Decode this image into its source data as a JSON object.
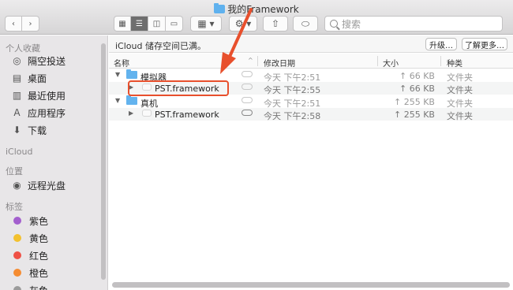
{
  "window": {
    "title": "我的Framework"
  },
  "toolbar": {
    "back": "‹",
    "forward": "›",
    "view_icon": "▦",
    "view_list": "☰",
    "view_column": "◫",
    "view_gallery": "▭",
    "group_label": "▦ ▾",
    "action_label": "⚙ ▾",
    "share_label": "⇧",
    "tag_label": "⬭",
    "search_placeholder": "搜索"
  },
  "sidebar": {
    "favorites_header": "个人收藏",
    "favorites": [
      {
        "label": "隔空投送",
        "icon": "airdrop-icon"
      },
      {
        "label": "桌面",
        "icon": "desktop-icon"
      },
      {
        "label": "最近使用",
        "icon": "recents-icon"
      },
      {
        "label": "应用程序",
        "icon": "applications-icon"
      },
      {
        "label": "下载",
        "icon": "downloads-icon"
      }
    ],
    "icloud_header": "iCloud",
    "locations_header": "位置",
    "locations": [
      {
        "label": "远程光盘",
        "icon": "disc-icon"
      }
    ],
    "tags_header": "标签",
    "tags": [
      {
        "label": "紫色",
        "color": "#a35fce"
      },
      {
        "label": "黄色",
        "color": "#f3c12f"
      },
      {
        "label": "红色",
        "color": "#ef5045"
      },
      {
        "label": "橙色",
        "color": "#f58c32"
      },
      {
        "label": "灰色",
        "color": "#9b9b9b"
      }
    ]
  },
  "icloud_bar": {
    "message": "iCloud 储存空间已满。",
    "upgrade": "升级…",
    "learn_more": "了解更多…"
  },
  "columns": {
    "name": "名称",
    "date": "修改日期",
    "size": "大小",
    "kind": "种类"
  },
  "rows": [
    {
      "name": "模拟器",
      "date": "今天 下午2:51",
      "size": "↑ 66 KB",
      "kind": "文件夹"
    },
    {
      "name": "PST.framework",
      "date": "今天 下午2:55",
      "size": "↑ 66 KB",
      "kind": "文件夹"
    },
    {
      "name": "真机",
      "date": "今天 下午2:51",
      "size": "↑ 255 KB",
      "kind": "文件夹"
    },
    {
      "name": "PST.framework",
      "date": "今天 下午2:58",
      "size": "↑ 255 KB",
      "kind": "文件夹"
    }
  ],
  "colors": {
    "accent_folder": "#63b3ee",
    "annotation": "#e8502d"
  }
}
